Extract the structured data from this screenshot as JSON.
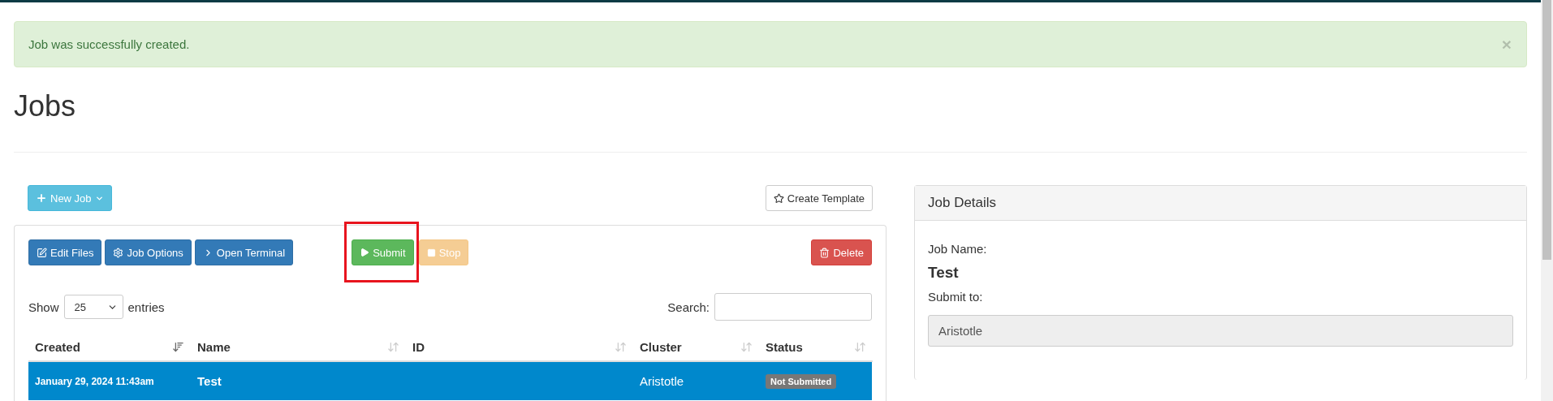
{
  "alert": {
    "message": "Job was successfully created.",
    "close": "×"
  },
  "title": "Jobs",
  "top_actions": [
    {
      "label": "New Job",
      "kind": "info"
    },
    {
      "label": "Create Template",
      "kind": "default"
    }
  ],
  "toolbar": [
    {
      "label": "Edit Files",
      "kind": "primary",
      "disabled": false,
      "highlighted": false
    },
    {
      "label": "Job Options",
      "kind": "primary",
      "disabled": false,
      "highlighted": false
    },
    {
      "label": "Open Terminal",
      "kind": "primary",
      "disabled": false,
      "highlighted": false
    },
    {
      "label": "Submit",
      "kind": "success",
      "disabled": false,
      "highlighted": true
    },
    {
      "label": "Stop",
      "kind": "warning",
      "disabled": true,
      "highlighted": false
    },
    {
      "label": "Delete",
      "kind": "danger",
      "disabled": false,
      "highlighted": false
    }
  ],
  "length": {
    "before": "Show",
    "value": "25",
    "after": "entries"
  },
  "search": {
    "label": "Search:"
  },
  "table": {
    "columns": [
      {
        "label": "Created",
        "sorted": true
      },
      {
        "label": "Name",
        "sorted": false
      },
      {
        "label": "ID",
        "sorted": false
      },
      {
        "label": "Cluster",
        "sorted": false
      },
      {
        "label": "Status",
        "sorted": false
      }
    ],
    "rows": [
      {
        "created": "January 29, 2024 11:43am",
        "name": "Test",
        "id": "",
        "cluster": "Aristotle",
        "status": "Not Submitted",
        "selected": true
      }
    ]
  },
  "details": {
    "title": "Job Details",
    "name_label": "Job Name:",
    "name": "Test",
    "submit_label": "Submit to:",
    "submit_value": "Aristotle"
  }
}
